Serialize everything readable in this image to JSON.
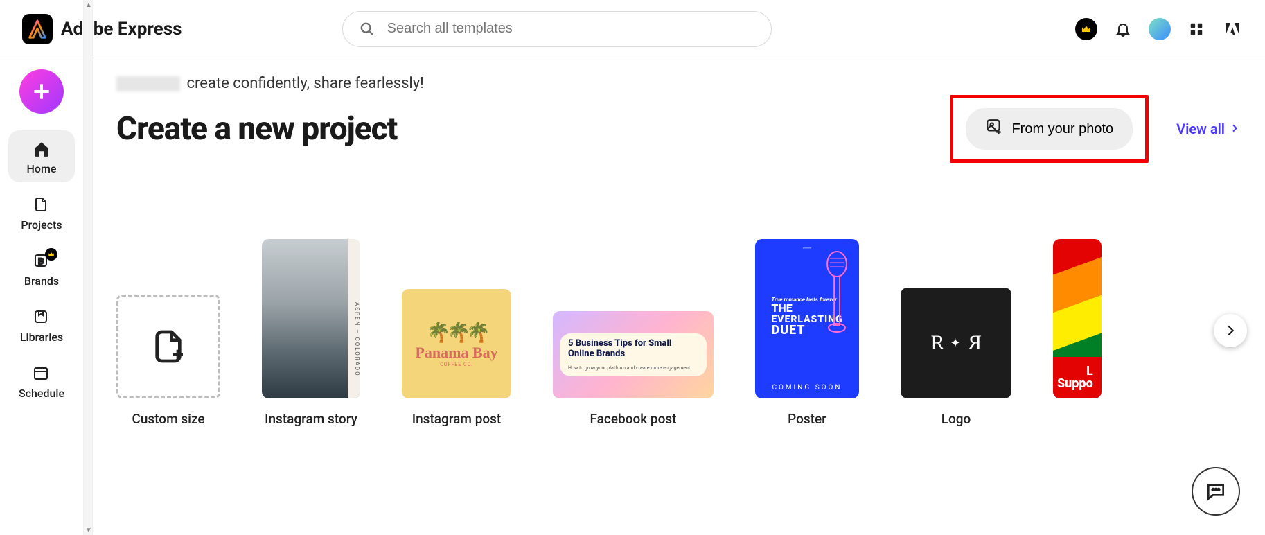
{
  "header": {
    "app_name": "Adobe Express",
    "search_placeholder": "Search all templates"
  },
  "sidebar": {
    "items": [
      {
        "label": "Home"
      },
      {
        "label": "Projects"
      },
      {
        "label": "Brands"
      },
      {
        "label": "Libraries"
      },
      {
        "label": "Schedule"
      }
    ]
  },
  "main": {
    "greeting_suffix": "create confidently, share fearlessly!",
    "heading": "Create a new project",
    "from_photo_label": "From your photo",
    "view_all_label": "View all"
  },
  "cards": [
    {
      "label": "Custom size"
    },
    {
      "label": "Instagram story"
    },
    {
      "label": "Instagram post"
    },
    {
      "label": "Facebook post"
    },
    {
      "label": "Poster"
    },
    {
      "label": "Logo"
    }
  ],
  "thumbs": {
    "ig_story_strip": "ASPEN – COLORADO",
    "ig_post_title": "Panama Bay",
    "ig_post_sub": "COFFEE CO.",
    "fb_title": "5 Business Tips for Small Online Brands",
    "fb_sub": "How to grow your platform and create more engagement",
    "poster_tag": "True romance lasts forever",
    "poster_l2": "THE",
    "poster_l3": "EVERLASTING",
    "poster_l4": "DUET",
    "poster_coming": "COMING SOON",
    "logo_text_l": "R",
    "logo_text_r": "R",
    "rainbow_line1": "L",
    "rainbow_line2": "Suppo"
  }
}
